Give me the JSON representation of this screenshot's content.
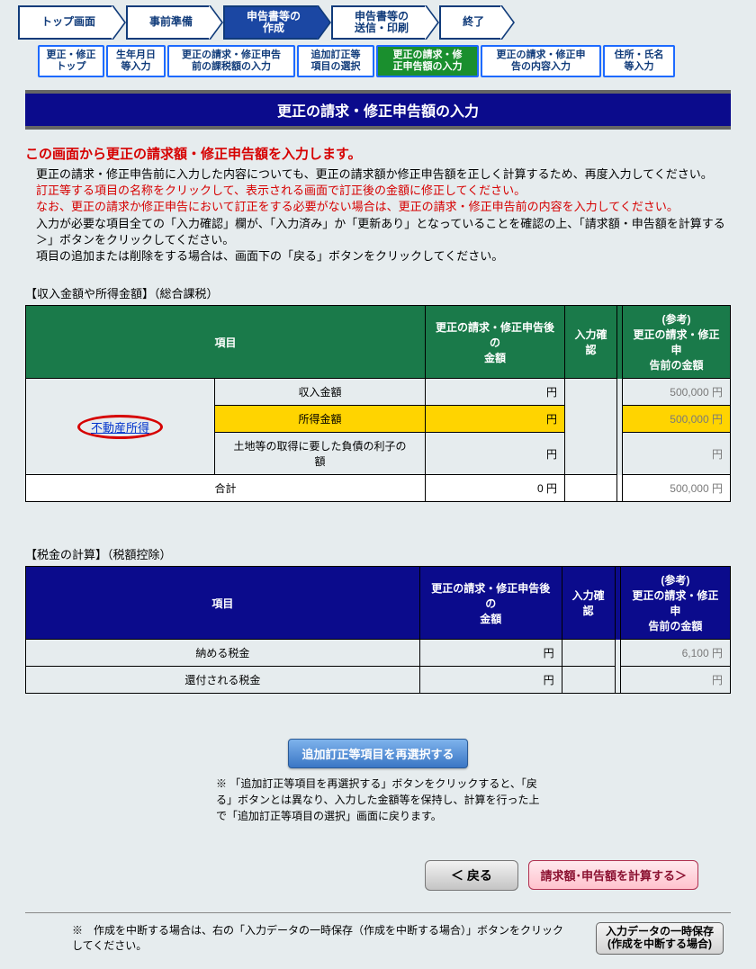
{
  "top_steps": [
    "トップ画面",
    "事前準備",
    "申告書等の\n作成",
    "申告書等の\n送信・印刷",
    "終了"
  ],
  "sub_steps": [
    "更正・修正\nトップ",
    "生年月日\n等入力",
    "更正の請求・修正申告\n前の課税額の入力",
    "追加訂正等\n項目の選択",
    "更正の請求・修\n正申告額の入力",
    "更正の請求・修正申\n告の内容入力",
    "住所・氏名\n等入力"
  ],
  "title": "更正の請求・修正申告額の入力",
  "intro": {
    "heading": "この画面から更正の請求額・修正申告額を入力します。",
    "p1": "更正の請求・修正申告前に入力した内容についても、更正の請求額か修正申告額を正しく計算するため、再度入力してください。",
    "p2": "訂正等する項目の名称をクリックして、表示される画面で訂正後の金額に修正してください。",
    "p3": "なお、更正の請求か修正申告において訂正をする必要がない場合は、更正の請求・修正申告前の内容を入力してください。",
    "p4": "入力が必要な項目全ての「入力確認」欄が、「入力済み」か「更新あり」となっていることを確認の上、「請求額・申告額を計算する＞」ボタンをクリックしてください。",
    "p5": "項目の追加または削除をする場合は、画面下の「戻る」ボタンをクリックしてください。"
  },
  "section1_label": "【収入金額や所得金額】（総合課税）",
  "headers": {
    "item": "項目",
    "after": "更正の請求・修正申告後の\n金額",
    "confirm": "入力確認",
    "ref": "(参考)\n更正の請求・修正申\n告前の金額"
  },
  "t1": {
    "link": "不動産所得",
    "rows": [
      {
        "label": "収入金額",
        "after": "円",
        "ref": "500,000 円"
      },
      {
        "label": "所得金額",
        "after": "円",
        "ref": "500,000 円",
        "hl": true
      },
      {
        "label": "土地等の取得に要した負債の利子の\n額",
        "after": "円",
        "ref": "円"
      }
    ],
    "total_label": "合計",
    "total_after": "0 円",
    "total_ref": "500,000 円"
  },
  "section2_label": "【税金の計算】（税額控除）",
  "t2": {
    "rows": [
      {
        "label": "納める税金",
        "after": "円",
        "ref": "6,100 円"
      },
      {
        "label": "還付される税金",
        "after": "円",
        "ref": "円"
      }
    ]
  },
  "btn_reselect": "追加訂正等項目を再選択する",
  "reselect_note": "※ 「追加訂正等項目を再選択する」ボタンをクリックすると、「戻る」ボタンとは異なり、入力した金額等を保持し、計算を行った上で「追加訂正等項目の選択」画面に戻ります。",
  "btn_back": "＜ 戻る",
  "btn_calc": "請求額･申告額を計算する＞",
  "save_note": "※　作成を中断する場合は、右の「入力データの一時保存（作成を中断する場合）」ボタンをクリックしてください。",
  "btn_save": "入力データの一時保存\n(作成を中断する場合)"
}
